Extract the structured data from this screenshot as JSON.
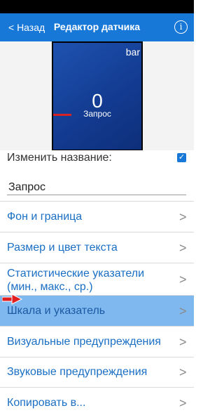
{
  "nav": {
    "back_label": "< Назад",
    "title": "Редактор датчика",
    "info_glyph": "i"
  },
  "preview": {
    "corner_text": "bar",
    "value": "0",
    "label": "Запрос",
    "tile_color": "#1e52b0",
    "marker_color": "#d62222"
  },
  "rename": {
    "label": "Изменить название:",
    "checked": true,
    "value": "Запрос"
  },
  "menu": {
    "chevron": ">",
    "items": [
      {
        "label": "Фон и граница"
      },
      {
        "label": "Размер и цвет текста"
      },
      {
        "label": "Статистические указатели (мин., макс., ср.)"
      },
      {
        "label": "Шкала и указатель"
      },
      {
        "label": "Визуальные предупреждения"
      },
      {
        "label": "Звуковые предупреждения"
      },
      {
        "label": "Копировать в..."
      }
    ]
  },
  "colors": {
    "accent": "#1878d8",
    "link_text": "#1a6fc4",
    "selected_row": "#7fb8ef",
    "pointer_arrow": "#e02020"
  }
}
